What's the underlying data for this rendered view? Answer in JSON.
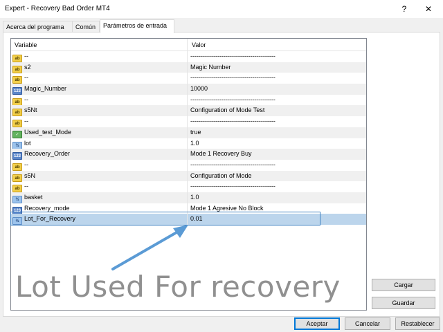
{
  "window": {
    "title": "Expert - Recovery Bad Order MT4",
    "help_glyph": "?",
    "close_glyph": "✕"
  },
  "tabs": [
    {
      "label": "Acerca del programa"
    },
    {
      "label": "Común"
    },
    {
      "label": "Parámetros de entrada"
    }
  ],
  "grid": {
    "header_variable": "Variable",
    "header_value": "Valor",
    "rows": [
      {
        "icon": "ab",
        "variable": "--",
        "value": "-----------------------------------------"
      },
      {
        "icon": "ab",
        "variable": "s2",
        "value": "Magic Number"
      },
      {
        "icon": "ab",
        "variable": "--",
        "value": "-----------------------------------------"
      },
      {
        "icon": "123",
        "variable": "Magic_Number",
        "value": "10000"
      },
      {
        "icon": "ab",
        "variable": "--",
        "value": "-----------------------------------------"
      },
      {
        "icon": "ab",
        "variable": "s5Nt",
        "value": "Configuration of Mode Test"
      },
      {
        "icon": "ab",
        "variable": "--",
        "value": "-----------------------------------------"
      },
      {
        "icon": "bool",
        "variable": "Used_test_Mode",
        "value": "true"
      },
      {
        "icon": "frac",
        "variable": "lot",
        "value": "1.0"
      },
      {
        "icon": "123",
        "variable": "Recovery_Order",
        "value": "Mode 1 Recovery Buy"
      },
      {
        "icon": "ab",
        "variable": "--",
        "value": "-----------------------------------------"
      },
      {
        "icon": "ab",
        "variable": "s5N",
        "value": "Configuration of Mode"
      },
      {
        "icon": "ab",
        "variable": "--",
        "value": "-----------------------------------------"
      },
      {
        "icon": "frac",
        "variable": "basket",
        "value": "1.0"
      },
      {
        "icon": "123",
        "variable": "Recovery_mode",
        "value": "Mode 1 Agresive No Block"
      },
      {
        "icon": "frac",
        "variable": "Lot_For_Recovery",
        "value": "0.01"
      }
    ]
  },
  "icon_labels": {
    "ab": "ab",
    "123": "123",
    "frac": "½",
    "bool": "✓"
  },
  "annotation": {
    "text": "Lot Used For recovery",
    "arrow_color": "#5b9bd5"
  },
  "buttons": {
    "load": "Cargar",
    "save": "Guardar",
    "ok": "Aceptar",
    "cancel": "Cancelar",
    "reset": "Restablecer"
  }
}
